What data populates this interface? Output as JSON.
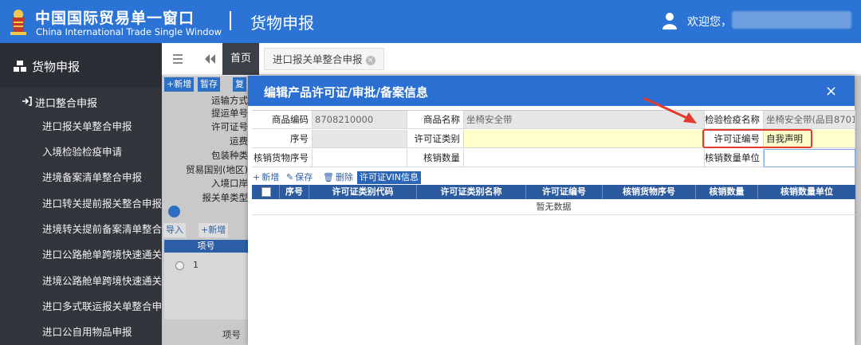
{
  "header": {
    "brand_cn": "中国国际贸易单一窗口",
    "brand_en": "China International Trade Single Window",
    "title": "货物申报",
    "welcome": "欢迎您，"
  },
  "sidebar": {
    "head": "货物申报",
    "group": "进口整合申报",
    "items": [
      "进口报关单整合申报",
      "入境检验检疫申请",
      "进境备案清单整合申报",
      "进口转关提前报关整合申报",
      "进境转关提前备案清单整合申报",
      "进口公路舱单跨境快速通关",
      "进境公路舱单跨境快速通关",
      "进口多式联运报关单整合申报",
      "进口公自用物品申报"
    ]
  },
  "tabs": {
    "home": "首页",
    "active": "进口报关单整合申报",
    "close": "×"
  },
  "background": {
    "toolbar": [
      "+新增",
      "暂存",
      "复"
    ],
    "labels": [
      "运输方式",
      "提运单号",
      "许可证号",
      "运费",
      "包装种类",
      "贸易国别(地区)",
      "入境口岸",
      "报关单类型"
    ],
    "toolbar2": [
      "导入",
      "+新增"
    ],
    "table_head": "项号",
    "row_num": "1",
    "bottom_label": "项号"
  },
  "modal": {
    "title": "编辑产品许可证/审批/备案信息",
    "close": "×",
    "fields": {
      "goods_code_label": "商品编码",
      "goods_code_value": "8708210000",
      "goods_name_label": "商品名称",
      "goods_name_value": "坐椅安全带",
      "ciq_name_label": "检验检疫名称",
      "ciq_name_value": "坐椅安全带(品目8701",
      "seq_label": "序号",
      "seq_value": "",
      "license_type_label": "许可证类别",
      "license_type_value": "",
      "license_no_label": "许可证编号",
      "license_no_value": "自我声明",
      "writeoff_seq_label": "核销货物序号",
      "writeoff_seq_value": "",
      "writeoff_qty_label": "核销数量",
      "writeoff_qty_value": "",
      "writeoff_unit_label": "核销数量单位",
      "writeoff_unit_value": ""
    },
    "toolbar": {
      "add": "新增",
      "save": "保存",
      "delete": "删除",
      "vin": "许可证VIN信息"
    },
    "grid": {
      "columns": [
        "序号",
        "许可证类别代码",
        "许可证类别名称",
        "许可证编号",
        "核销货物序号",
        "核销数量",
        "核销数量单位"
      ],
      "empty": "暂无数据"
    }
  },
  "colors": {
    "header_blue": "#2b73d4",
    "sidebar_dark": "#32353c",
    "grid_head": "#2c5a9f",
    "highlight_red": "#e23b2e"
  }
}
